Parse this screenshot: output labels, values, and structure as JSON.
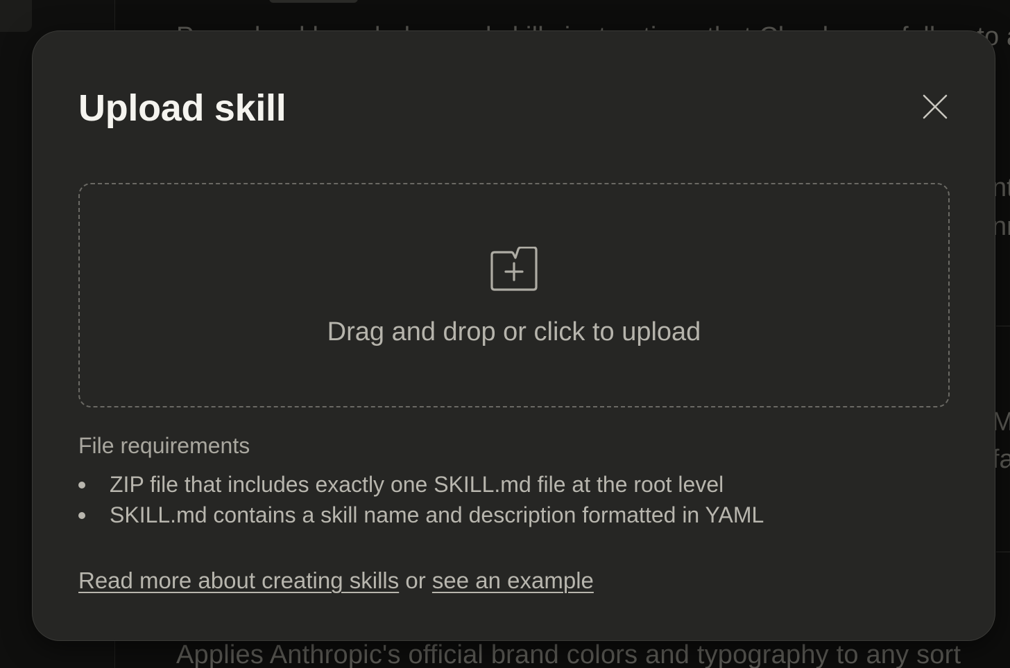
{
  "background": {
    "top_text": "Procedural knowledge and skills instructions that Claude can follow to any",
    "bottom_text": "Applies Anthropic's official brand colors and typography to any sort",
    "right_fragments": [
      "nt",
      "nn",
      "M",
      "fa"
    ]
  },
  "modal": {
    "title": "Upload skill",
    "close_icon": "close-icon",
    "dropzone": {
      "icon": "folder-plus-icon",
      "text": "Drag and drop or click to upload"
    },
    "requirements": {
      "title": "File requirements",
      "items": [
        "ZIP file that includes exactly one SKILL.md file at the root level",
        "SKILL.md contains a skill name and description formatted in YAML"
      ]
    },
    "footer": {
      "link1": "Read more about creating skills",
      "connector": " or ",
      "link2": "see an example"
    }
  },
  "colors": {
    "modal_bg": "#262624",
    "page_bg": "#0d0d0c",
    "title": "#f5f4ef",
    "body_text": "#b8b6ae",
    "dashed_border": "#6a6964"
  }
}
